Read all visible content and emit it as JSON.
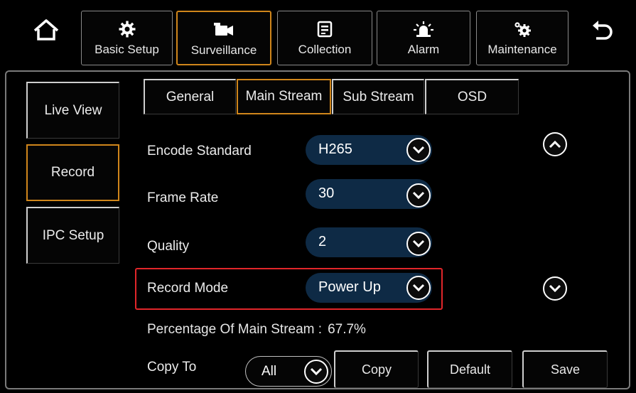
{
  "topnav": {
    "items": [
      {
        "label": "Basic Setup",
        "icon": "gear-icon"
      },
      {
        "label": "Surveillance",
        "icon": "camera-icon",
        "active": true
      },
      {
        "label": "Collection",
        "icon": "document-icon"
      },
      {
        "label": "Alarm",
        "icon": "alarm-light-icon"
      },
      {
        "label": "Maintenance",
        "icon": "gears-icon"
      }
    ],
    "home_icon": "home-icon",
    "back_icon": "back-arrow-icon"
  },
  "sidebar": {
    "items": [
      {
        "label": "Live View"
      },
      {
        "label": "Record",
        "active": true
      },
      {
        "label": "IPC Setup"
      }
    ]
  },
  "tabs": [
    {
      "label": "General"
    },
    {
      "label": "Main Stream",
      "active": true
    },
    {
      "label": "Sub Stream"
    },
    {
      "label": "OSD"
    }
  ],
  "form": {
    "encode_standard": {
      "label": "Encode Standard",
      "value": "H265"
    },
    "frame_rate": {
      "label": "Frame Rate",
      "value": "30"
    },
    "quality": {
      "label": "Quality",
      "value": "2"
    },
    "record_mode": {
      "label": "Record Mode",
      "value": "Power Up"
    },
    "percentage": {
      "label": "Percentage Of Main Stream :",
      "value": "67.7%"
    },
    "copy_to": {
      "label": "Copy To",
      "value": "All"
    }
  },
  "buttons": {
    "copy": "Copy",
    "default": "Default",
    "save": "Save"
  },
  "colors": {
    "active_border": "#d0861b",
    "highlight": "#e1262a",
    "select_bg": "#0e2a45"
  }
}
